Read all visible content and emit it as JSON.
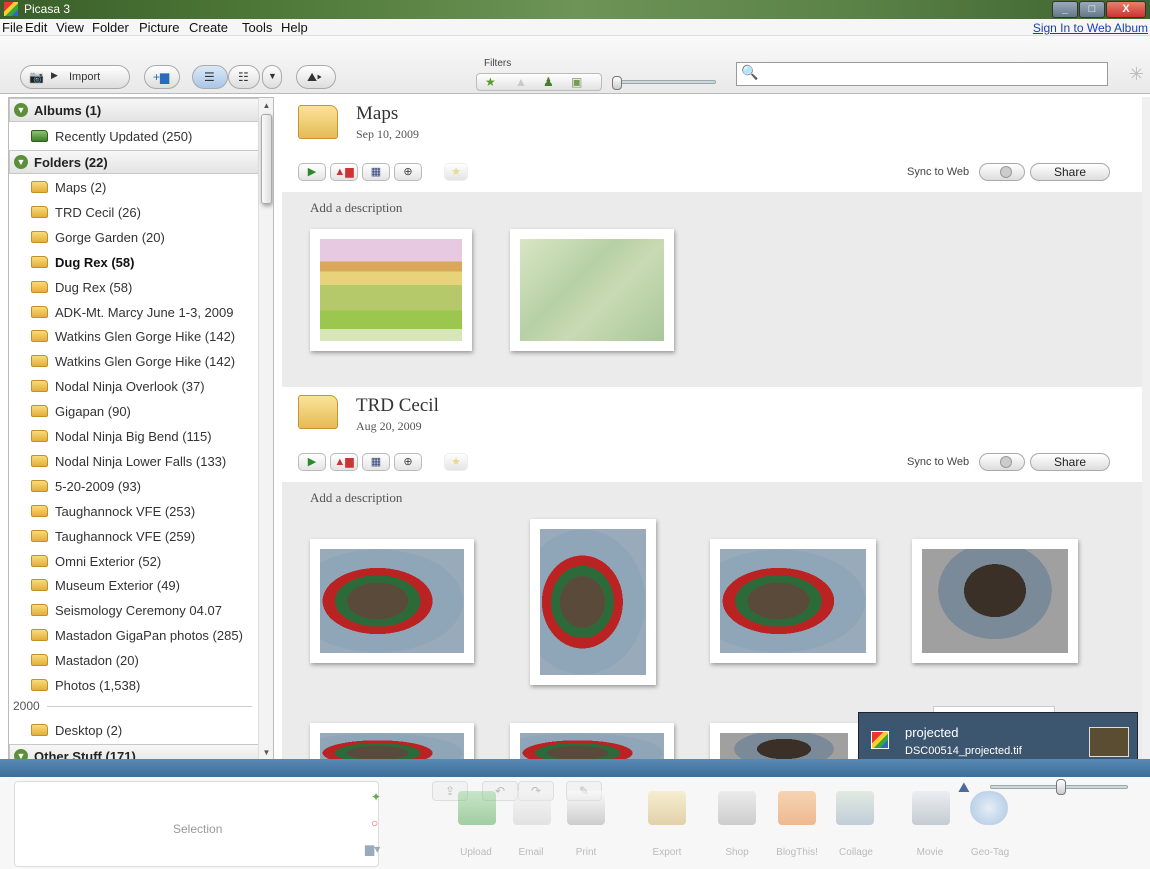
{
  "window": {
    "title": "Picasa 3",
    "min": "_",
    "max": "□",
    "close": "X"
  },
  "menu": {
    "items": [
      "File",
      "Edit",
      "View",
      "Folder",
      "Picture",
      "Create",
      "Tools",
      "Help"
    ],
    "sign_in": "Sign In to Web Album"
  },
  "toolbar": {
    "import_label": "Import",
    "filters_label": "Filters",
    "search_placeholder": ""
  },
  "sidebar": {
    "albums_header": "Albums (1)",
    "albums": [
      {
        "label": "Recently Updated (250)"
      }
    ],
    "folders_header": "Folders (22)",
    "folders": [
      {
        "label": "Maps (2)",
        "bold": false
      },
      {
        "label": "TRD Cecil (26)",
        "bold": false
      },
      {
        "label": "Gorge Garden (20)",
        "bold": false
      },
      {
        "label": "Dug Rex (58)",
        "bold": true
      },
      {
        "label": "Dug Rex (58)",
        "bold": false
      },
      {
        "label": "ADK-Mt. Marcy June 1-3, 2009",
        "bold": false
      },
      {
        "label": "Watkins Glen Gorge Hike (142)",
        "bold": false
      },
      {
        "label": "Watkins Glen Gorge Hike (142)",
        "bold": false
      },
      {
        "label": "Nodal Ninja Overlook (37)",
        "bold": false
      },
      {
        "label": "Gigapan (90)",
        "bold": false
      },
      {
        "label": "Nodal Ninja Big Bend (115)",
        "bold": false
      },
      {
        "label": "Nodal Ninja Lower Falls (133)",
        "bold": false
      },
      {
        "label": "5-20-2009 (93)",
        "bold": false
      },
      {
        "label": "Taughannock VFE (253)",
        "bold": false
      },
      {
        "label": "Taughannock VFE (259)",
        "bold": false
      },
      {
        "label": "Omni Exterior (52)",
        "bold": false
      },
      {
        "label": "Museum Exterior (49)",
        "bold": false
      },
      {
        "label": "Seismology Ceremony 04.07",
        "bold": false
      },
      {
        "label": "Mastadon GigaPan photos (285)",
        "bold": false
      },
      {
        "label": "Mastadon (20)",
        "bold": false
      },
      {
        "label": "Photos (1,538)",
        "bold": false
      }
    ],
    "year_label": "2000",
    "desktop": "Desktop (2)",
    "other_header": "Other Stuff (171)"
  },
  "main": {
    "groups": [
      {
        "title": "Maps",
        "date": "Sep 10, 2009",
        "sync_label": "Sync to Web",
        "share_label": "Share",
        "description": "Add a description"
      },
      {
        "title": "TRD Cecil",
        "date": "Aug 20, 2009",
        "sync_label": "Sync to Web",
        "share_label": "Share",
        "description": "Add a description"
      }
    ]
  },
  "notification": {
    "title": "projected",
    "filename": "DSC00514_projected.tif"
  },
  "bottom": {
    "selection_label": "Selection",
    "actions": [
      "Upload",
      "Email",
      "Print",
      "Export",
      "Shop",
      "BlogThis!",
      "Collage",
      "Movie",
      "Geo-Tag"
    ]
  },
  "colors": {
    "accent": "#3d6f9c",
    "titlebar": "#4f7a38"
  }
}
